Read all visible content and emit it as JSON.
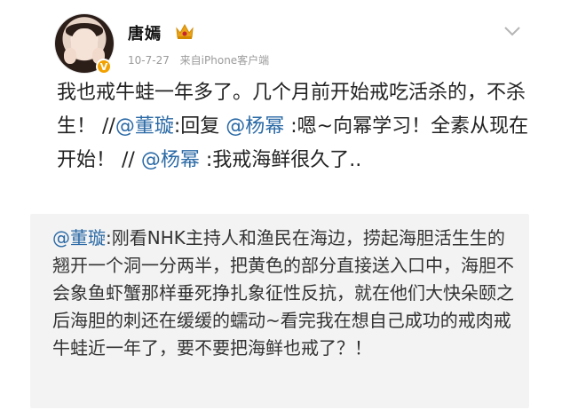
{
  "post": {
    "author": {
      "name": "唐嫣",
      "verified_badge": "V"
    },
    "meta": {
      "date": "10-7-27",
      "source": "来自iPhone客户端"
    },
    "content": {
      "p1": "我也戒牛蛙一年多了。几个月前开始戒吃活杀的，不杀生！ //",
      "m1": "@董璇",
      "p2": ":回复 ",
      "m2": "@杨幂",
      "p3": " :嗯~向幂学习！全素从现在开始！ // ",
      "m3": "@杨幂",
      "p4": " :我戒海鲜很久了.."
    },
    "repost": {
      "mention": "@董璇",
      "text": ":刚看NHK主持人和渔民在海边，捞起海胆活生生的翘开一个洞一分两半，把黄色的部分直接送入口中，海胆不会象鱼虾蟹那样垂死挣扎象征性反抗，就在他们大快朵颐之后海胆的刺还在缓缓的蠕动~看完我在想自己成功的戒肉戒牛蛙近一年了，要不要把海鲜也戒了？！"
    }
  },
  "icons": {
    "crown": "crown-icon",
    "chevron": "chevron-down-icon",
    "verified": "verified-badge-icon"
  },
  "colors": {
    "mention": "#2b6aa6",
    "repost_bg": "#f3f3f3",
    "badge": "#f2a100",
    "meta": "#9b9b9b"
  }
}
